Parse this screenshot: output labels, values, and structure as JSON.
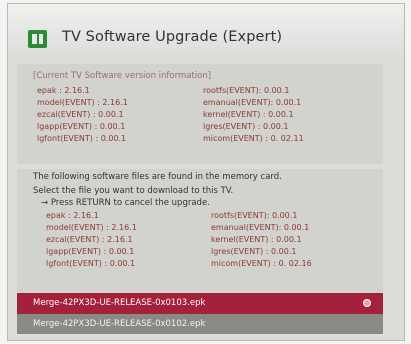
{
  "window": {
    "title": "TV Software Upgrade (Expert)"
  },
  "current": {
    "header": "[Current TV Software version information]",
    "left": [
      "epak : 2.16.1",
      "model(EVENT) : 2.16.1",
      "ezcal(EVENT) : 0.00.1",
      "lgapp(EVENT) : 0.00.1",
      "lgfont(EVENT) : 0.00.1"
    ],
    "right": [
      "rootfs(EVENT): 0.00.1",
      "emanual(EVENT): 0.00.1",
      "kernel(EVENT) : 0.00.1",
      "lgres(EVENT) : 0.00.1",
      "micom(EVENT) : 0. 02.11"
    ]
  },
  "found": {
    "line1": "The following software files are found in the memory card.",
    "line2": "Select the file you want to download to this TV.",
    "line3": "→ Press RETURN to cancel the upgrade.",
    "left": [
      "epak : 2.16.1",
      "model(EVENT) : 2.16.1",
      "ezcal(EVENT) : 2.16.1",
      "lgapp(EVENT) : 0.00.1",
      "lgfont(EVENT) : 0.00.1"
    ],
    "right": [
      "rootfs(EVENT): 0.00.1",
      "emanual(EVENT): 0.00.1",
      "kernel(EVENT) : 0.00.1",
      "lgres(EVENT) : 0.00.1",
      "micom(EVENT) : 0. 02.16"
    ]
  },
  "files": [
    {
      "name": "Merge-42PX3D-UE-RELEASE-0x0103.epk",
      "selected": true
    },
    {
      "name": "Merge-42PX3D-UE-RELEASE-0x0102.epk",
      "selected": false
    }
  ],
  "colors": {
    "selected": "#a3213a",
    "unselected": "#898987",
    "version_text": "#8a3b30"
  }
}
